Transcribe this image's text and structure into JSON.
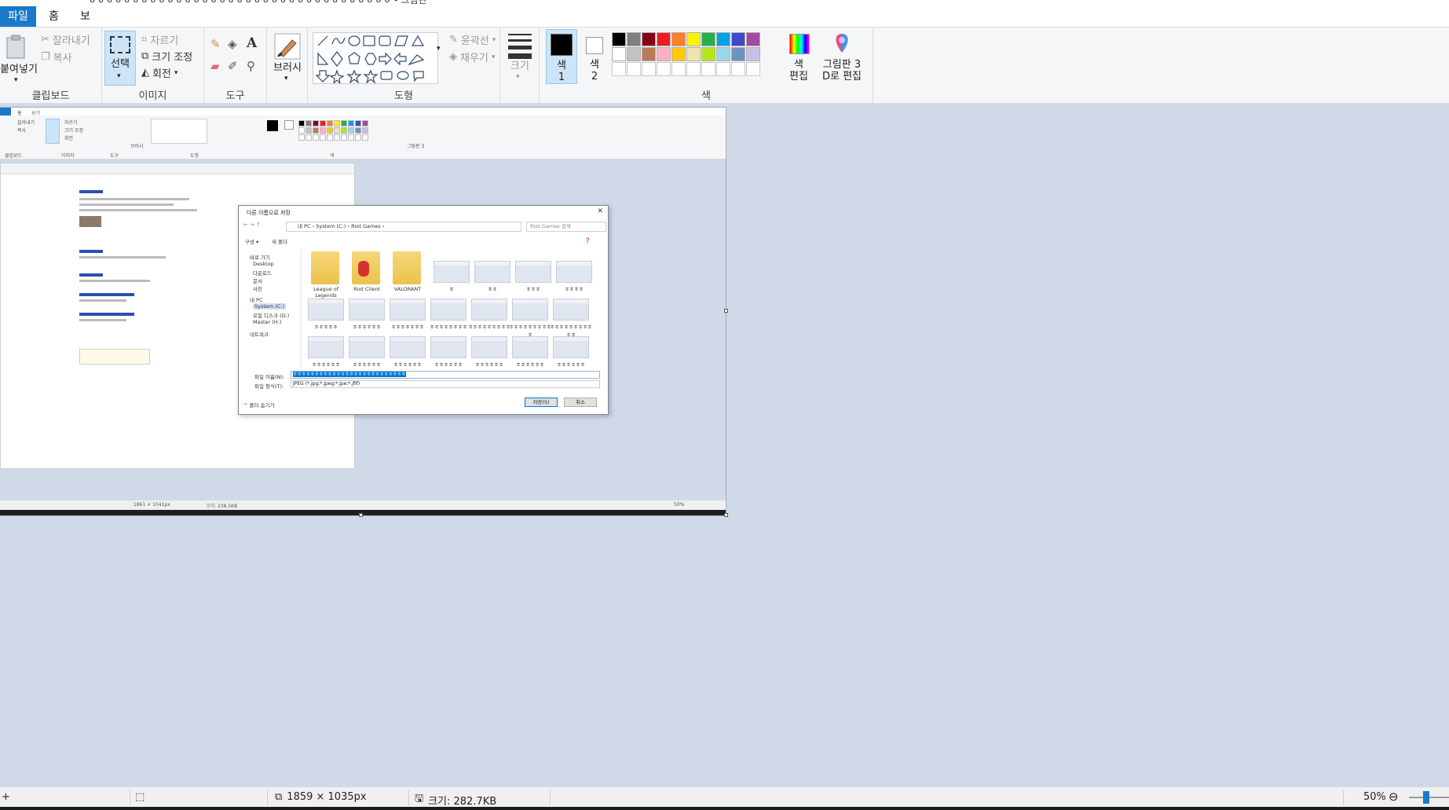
{
  "window": {
    "title": "ㅎㅎㅎㅎㅎㅎㅎㅎㅎㅎㅎㅎㅎㅎㅎㅎㅎㅎㅎㅎㅎㅎㅎㅎㅎㅎㅎㅎㅎㅎㅎㅎㅎㅎㅎ - 그림판"
  },
  "menu": {
    "file": "파일",
    "home": "홈",
    "view": "보기"
  },
  "ribbon": {
    "clipboard": {
      "paste": "붙여넣기",
      "cut": "잘라내기",
      "copy": "복사",
      "label": "클립보드"
    },
    "image": {
      "select": "선택",
      "crop": "자르기",
      "resize": "크기 조정",
      "rotate": "회전",
      "label": "이미지"
    },
    "tools": {
      "label": "도구"
    },
    "brushes": {
      "label": "브러시"
    },
    "shapes": {
      "outline": "윤곽선",
      "fill": "채우기",
      "label": "도형"
    },
    "size": {
      "label": "크기"
    },
    "colors": {
      "color1": "색\n1",
      "color1_l1": "색",
      "color1_l2": "1",
      "color2_l1": "색",
      "color2_l2": "2",
      "edit_l1": "색",
      "edit_l2": "편집",
      "paint3d_l1": "그림판 3",
      "paint3d_l2": "D로 편집",
      "label": "색",
      "palette_row1": [
        "#000000",
        "#7f7f7f",
        "#880015",
        "#ed1c24",
        "#ff7f27",
        "#fff200",
        "#22b14c",
        "#00a2e8",
        "#3f48cc",
        "#a349a4"
      ],
      "palette_row2": [
        "#ffffff",
        "#c3c3c3",
        "#b97a57",
        "#ffaec9",
        "#ffc90e",
        "#efe4b0",
        "#b5e61d",
        "#99d9ea",
        "#7092be",
        "#c8bfe7"
      ]
    }
  },
  "dialog": {
    "title": "다른 이름으로 저장",
    "address": "내 PC  ›  System (C:)  ›  Riot Games  ›",
    "search_placeholder": "Riot Games 검색",
    "organize": "구성 ▾",
    "new_folder": "새 폴더",
    "nav": [
      "바로 가기",
      "Desktop",
      "다운로드",
      "문서",
      "사진",
      "내 PC",
      "System (C:)",
      "로컬 디스크 (D:)",
      "Master (H:)",
      "네트워크"
    ],
    "folders": [
      "League of Legends",
      "Riot Client",
      "VALORANT"
    ],
    "file_labels_row1": [
      "ㅎ",
      "ㅎㅎ",
      "ㅎㅎㅎ",
      "ㅎㅎㅎㅎ"
    ],
    "file_labels_row2": [
      "ㅎㅎㅎㅎㅎ",
      "ㅎㅎㅎㅎㅎㅎ",
      "ㅎㅎㅎㅎㅎㅎㅎ",
      "ㅎㅎㅎㅎㅎㅎㅎㅎ",
      "ㅎㅎㅎㅎㅎㅎㅎㅎㅎ",
      "ㅎㅎㅎㅎㅎㅎㅎㅎㅎㅎ",
      "ㅎㅎㅎㅎㅎㅎㅎㅎㅎㅎㅎ"
    ],
    "file_labels_row3": [
      "ㅎㅎㅎㅎㅎㅎ",
      "ㅎㅎㅎㅎㅎㅎ",
      "ㅎㅎㅎㅎㅎㅎ",
      "ㅎㅎㅎㅎㅎㅎ",
      "ㅎㅎㅎㅎㅎㅎ",
      "ㅎㅎㅎㅎㅎㅎ",
      "ㅎㅎㅎㅎㅎㅎ"
    ],
    "filename_label": "파일 이름(N):",
    "filename_value": "ㅎㅎㅎㅎㅎㅎㅎㅎㅎㅎㅎㅎㅎㅎㅎㅎㅎㅎㅎㅎㅎㅎㅎㅎㅎㅎ",
    "filetype_label": "파일 형식(T):",
    "filetype_value": "JPEG (*.jpg;*.jpeg;*.jpe;*.jfif)",
    "hide_folders": "폴더 숨기기",
    "save": "저장(S)",
    "cancel": "취소"
  },
  "inner_status": {
    "dims": "1861 × 1041px",
    "size": "크기: 238.5KB",
    "zoom": "50%"
  },
  "status": {
    "dimensions": "1859 × 1035px",
    "size": "크기: 282.7KB",
    "zoom": "50%"
  }
}
